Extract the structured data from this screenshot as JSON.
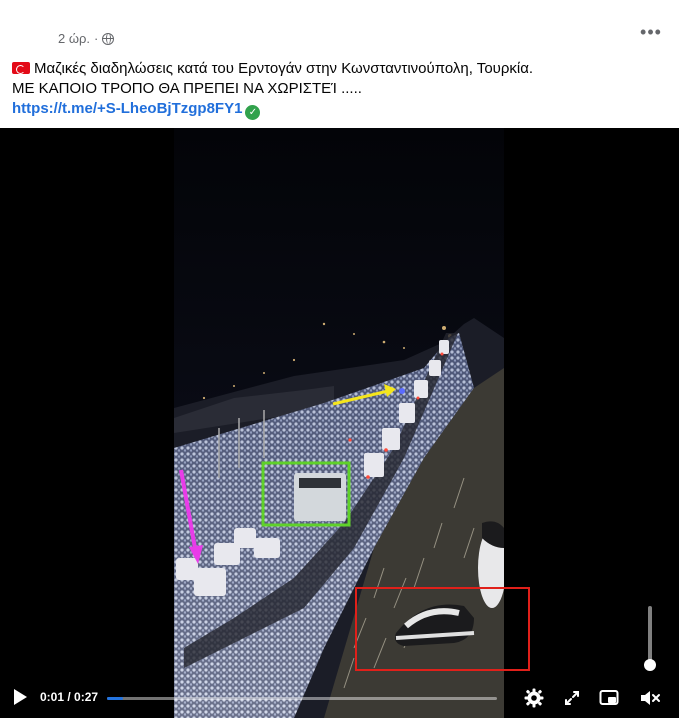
{
  "post": {
    "time": "2 ώρ.",
    "privacy_icon": "globe-icon",
    "more_icon": "more-horizontal-icon",
    "text_line1": "Μαζικές διαδηλώσεις κατά του Ερντογάν στην Κωνσταντινούπολη, Τουρκία.",
    "text_line2": "ΜΕ ΚΑΠΟΙΟ ΤΡΟΠΟ ΘΑ ΠΡΕΠΕΙ ΝΑ ΧΩΡΙΣΤΕΊ .....",
    "link": "https://t.me/+S-LheoBjTzgp8FY1",
    "flag_icon": "turkey-flag-icon",
    "verified_icon": "check-circle-icon"
  },
  "video": {
    "current_time": "0:01",
    "duration": "0:27",
    "time_display": "0:01 / 0:27",
    "progress": 0.04,
    "volume": 0.1,
    "icons": [
      "play-icon",
      "gear-icon",
      "fullscreen-icon",
      "picture-in-picture-icon",
      "mute-icon"
    ],
    "colors": {
      "progress": "#2374e1",
      "arrow_yellow": "#f5e61c",
      "arrow_magenta": "#e83ce8",
      "box_green": "#5fd12a",
      "box_red": "#e0201a"
    }
  }
}
